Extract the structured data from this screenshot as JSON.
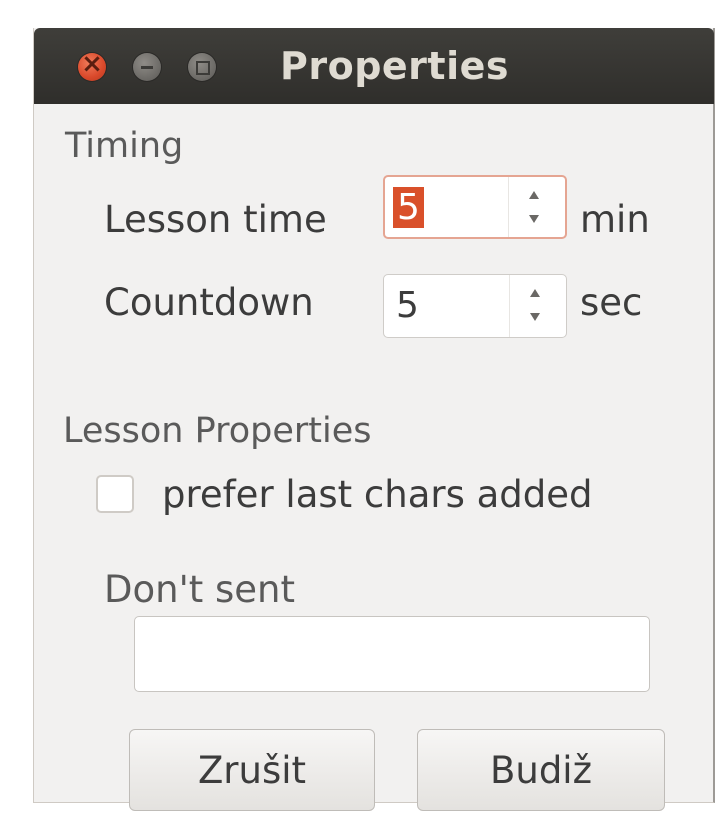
{
  "window": {
    "title": "Properties"
  },
  "timing": {
    "section_label": "Timing",
    "lesson_time": {
      "label": "Lesson time",
      "value": "5",
      "unit": "min"
    },
    "countdown": {
      "label": "Countdown",
      "value": "5",
      "unit": "sec"
    }
  },
  "lesson_properties": {
    "section_label": "Lesson Properties",
    "prefer_last_chars": {
      "label": "prefer last chars added",
      "checked": false
    },
    "dont_sent": {
      "label": "Don't sent",
      "value": ""
    }
  },
  "buttons": {
    "cancel": "Zrušit",
    "ok": "Budiž"
  },
  "colors": {
    "accent": "#d9502a",
    "titlebar": "#3a3935",
    "dialog_bg": "#f2f1f0"
  }
}
